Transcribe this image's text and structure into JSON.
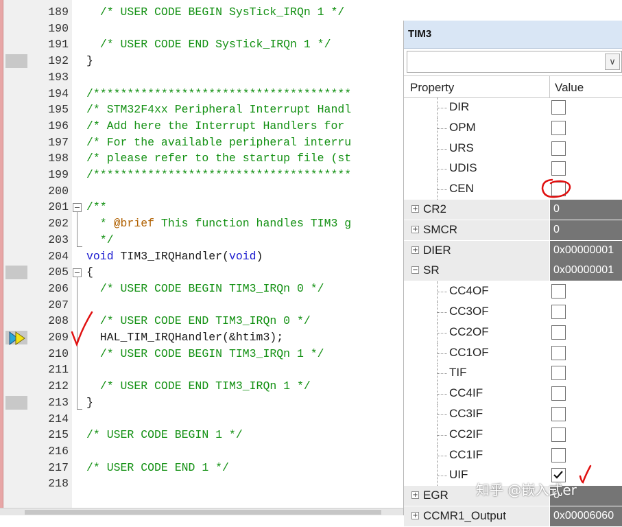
{
  "editor": {
    "lines": [
      {
        "num": "189",
        "html": "  <span class=\"cm\">/* USER CODE BEGIN SysTick_IRQn 1 */</span>"
      },
      {
        "num": "190",
        "html": ""
      },
      {
        "num": "191",
        "html": "  <span class=\"cm\">/* USER CODE END SysTick_IRQn 1 */</span>"
      },
      {
        "num": "192",
        "html": "}"
      },
      {
        "num": "193",
        "html": ""
      },
      {
        "num": "194",
        "html": "<span class=\"cm\">/**************************************</span>"
      },
      {
        "num": "195",
        "html": "<span class=\"cm\">/* STM32F4xx Peripheral Interrupt Handl</span>"
      },
      {
        "num": "196",
        "html": "<span class=\"cm\">/* Add here the Interrupt Handlers for </span>"
      },
      {
        "num": "197",
        "html": "<span class=\"cm\">/* For the available peripheral interru</span>"
      },
      {
        "num": "198",
        "html": "<span class=\"cm\">/* please refer to the startup file (st</span>"
      },
      {
        "num": "199",
        "html": "<span class=\"cm\">/**************************************</span>"
      },
      {
        "num": "200",
        "html": ""
      },
      {
        "num": "201",
        "html": "<span class=\"cm\">/**</span>"
      },
      {
        "num": "202",
        "html": "<span class=\"cm\">  * <span class=\"at\">@brief</span> This function handles TIM3 g</span>"
      },
      {
        "num": "203",
        "html": "<span class=\"cm\">  */</span>"
      },
      {
        "num": "204",
        "html": "<span class=\"kw\">void</span> TIM3_IRQHandler(<span class=\"kw\">void</span>)"
      },
      {
        "num": "205",
        "html": "{"
      },
      {
        "num": "206",
        "html": "  <span class=\"cm\">/* USER CODE BEGIN TIM3_IRQn 0 */</span>"
      },
      {
        "num": "207",
        "html": ""
      },
      {
        "num": "208",
        "html": "  <span class=\"cm\">/* USER CODE END TIM3_IRQn 0 */</span>"
      },
      {
        "num": "209",
        "html": "  HAL_TIM_IRQHandler(&amp;htim3);"
      },
      {
        "num": "210",
        "html": "  <span class=\"cm\">/* USER CODE BEGIN TIM3_IRQn 1 */</span>"
      },
      {
        "num": "211",
        "html": ""
      },
      {
        "num": "212",
        "html": "  <span class=\"cm\">/* USER CODE END TIM3_IRQn 1 */</span>"
      },
      {
        "num": "213",
        "html": "}"
      },
      {
        "num": "214",
        "html": ""
      },
      {
        "num": "215",
        "html": "<span class=\"cm\">/* USER CODE BEGIN 1 */</span>"
      },
      {
        "num": "216",
        "html": ""
      },
      {
        "num": "217",
        "html": "<span class=\"cm\">/* USER CODE END 1 */</span>"
      },
      {
        "num": "218",
        "html": ""
      }
    ]
  },
  "panel": {
    "title": "TIM3",
    "combo_arrow": "∨",
    "header_property": "Property",
    "header_value": "Value",
    "rows": [
      {
        "name": "DIR",
        "kind": "bit",
        "checked": false,
        "expander": ""
      },
      {
        "name": "OPM",
        "kind": "bit",
        "checked": false,
        "expander": ""
      },
      {
        "name": "URS",
        "kind": "bit",
        "checked": false,
        "expander": ""
      },
      {
        "name": "UDIS",
        "kind": "bit",
        "checked": false,
        "expander": ""
      },
      {
        "name": "CEN",
        "kind": "bit",
        "checked": false,
        "expander": ""
      },
      {
        "name": "CR2",
        "kind": "reg",
        "value": "0",
        "expander": "+"
      },
      {
        "name": "SMCR",
        "kind": "reg",
        "value": "0",
        "expander": "+"
      },
      {
        "name": "DIER",
        "kind": "reg",
        "value": "0x00000001",
        "expander": "+"
      },
      {
        "name": "SR",
        "kind": "reg",
        "value": "0x00000001",
        "expander": "−"
      },
      {
        "name": "CC4OF",
        "kind": "bit",
        "checked": false,
        "expander": ""
      },
      {
        "name": "CC3OF",
        "kind": "bit",
        "checked": false,
        "expander": ""
      },
      {
        "name": "CC2OF",
        "kind": "bit",
        "checked": false,
        "expander": ""
      },
      {
        "name": "CC1OF",
        "kind": "bit",
        "checked": false,
        "expander": ""
      },
      {
        "name": "TIF",
        "kind": "bit",
        "checked": false,
        "expander": ""
      },
      {
        "name": "CC4IF",
        "kind": "bit",
        "checked": false,
        "expander": ""
      },
      {
        "name": "CC3IF",
        "kind": "bit",
        "checked": false,
        "expander": ""
      },
      {
        "name": "CC2IF",
        "kind": "bit",
        "checked": false,
        "expander": ""
      },
      {
        "name": "CC1IF",
        "kind": "bit",
        "checked": false,
        "expander": ""
      },
      {
        "name": "UIF",
        "kind": "bit",
        "checked": true,
        "expander": ""
      },
      {
        "name": "EGR",
        "kind": "reg",
        "value": "0",
        "expander": "+"
      },
      {
        "name": "CCMR1_Output",
        "kind": "reg",
        "value": "0x00006060",
        "expander": "+"
      }
    ]
  },
  "watermark": "知乎 @嵌入式er",
  "colors": {
    "comment": "#129012",
    "keyword": "#1a1ad0",
    "annotation": "#e01010",
    "value_cell": "#757575"
  },
  "icons": [
    "current-line-arrow-icon",
    "fold-minus-icon",
    "expand-plus-icon",
    "collapse-minus-icon",
    "checkbox-icon",
    "dropdown-chevron-icon"
  ]
}
